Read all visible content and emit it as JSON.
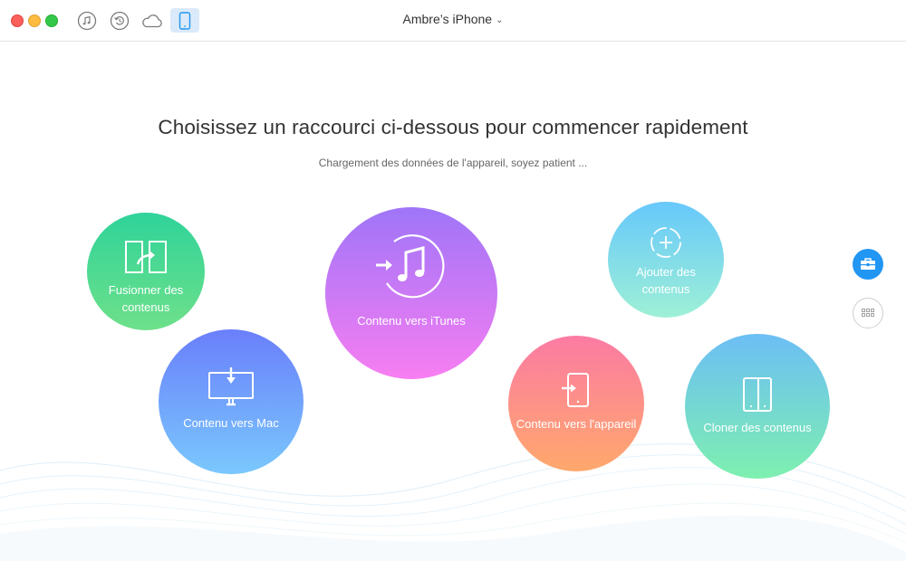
{
  "window": {
    "device_name": "Ambre’s iPhone",
    "toolbar_icons": [
      "music-icon",
      "restore-icon",
      "cloud-icon",
      "phone-icon"
    ]
  },
  "main": {
    "headline": "Choisissez un raccourci ci-dessous pour commencer rapidement",
    "subline": "Chargement des données de l'appareil, soyez patient ..."
  },
  "shortcuts": {
    "merge": {
      "label": "Fusionner des contenus",
      "icon": "merge-icon"
    },
    "to_mac": {
      "label": "Contenu vers Mac",
      "icon": "monitor-download-icon"
    },
    "to_itunes": {
      "label": "Contenu vers iTunes",
      "icon": "itunes-note-icon"
    },
    "add": {
      "label": "Ajouter des contenus",
      "icon": "add-circle-icon"
    },
    "to_device": {
      "label": "Contenu vers l'appareil",
      "icon": "phone-import-icon"
    },
    "clone": {
      "label": "Cloner des contenus",
      "icon": "clone-phones-icon"
    }
  },
  "side": {
    "toolkit_icon": "toolbox-icon",
    "grid_icon": "grid-icon"
  },
  "colors": {
    "accent": "#2196f3",
    "merge": [
      "#2fd39a",
      "#6ee08a"
    ],
    "to_mac": [
      "#6a7ffb",
      "#7ac8fd"
    ],
    "to_itunes": [
      "#9f75f8",
      "#f77ef2"
    ],
    "add": [
      "#67c8fb",
      "#9ef0d6"
    ],
    "to_device": [
      "#fc7ba3",
      "#fea86c"
    ],
    "clone": [
      "#6cbef5",
      "#7ef0b0"
    ]
  }
}
